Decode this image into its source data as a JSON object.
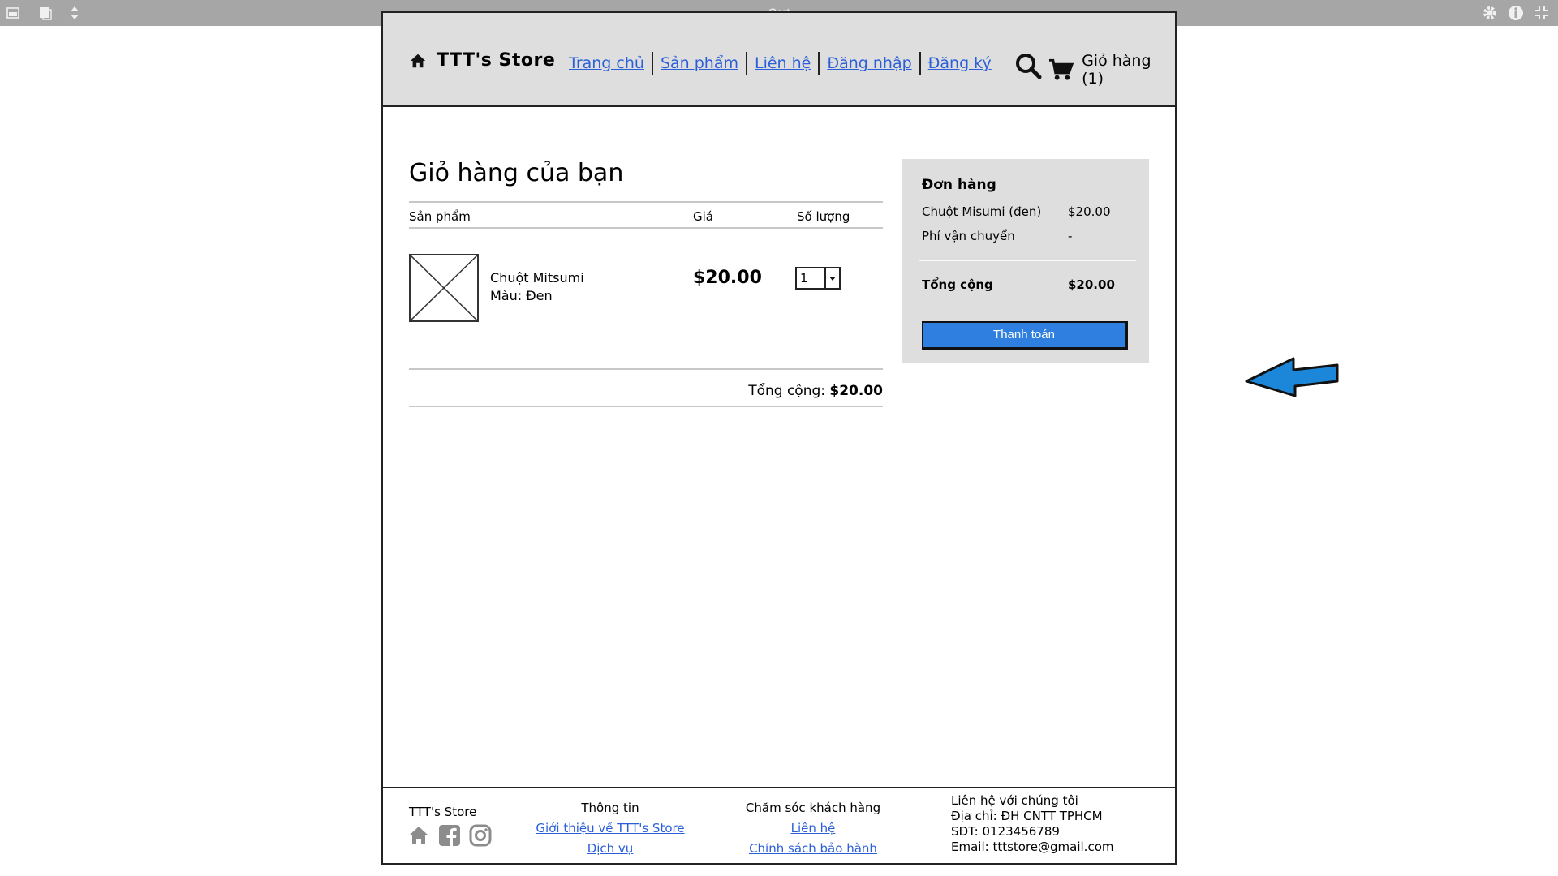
{
  "window": {
    "title": "Cart"
  },
  "header": {
    "brand": "TTT's Store",
    "nav": [
      "Trang chủ",
      "Sản phẩm",
      "Liên hệ",
      "Đăng nhập",
      "Đăng ký"
    ],
    "cart_label": "Giỏ hàng (1)"
  },
  "cart": {
    "title": "Giỏ hàng của bạn",
    "columns": {
      "product": "Sản phẩm",
      "price": "Giá",
      "quantity": "Số lượng"
    },
    "item": {
      "name": "Chuột Mitsumi",
      "color": "Màu: Đen",
      "price": "$20.00",
      "qty": "1"
    },
    "total_label": "Tổng cộng:",
    "total_value": "$20.00"
  },
  "order": {
    "heading": "Đơn hàng",
    "line_item": "Chuột Misumi (đen)",
    "line_value": "$20.00",
    "shipping": "Phí vận chuyển",
    "shipping_value": "-",
    "total_label": "Tổng cộng",
    "total_value": "$20.00",
    "pay_button": "Thanh toán"
  },
  "footer": {
    "brand": "TTT's Store",
    "info_title": "Thông tin",
    "info_links": [
      "Giới thiệu về TTT's Store",
      "Dịch vụ"
    ],
    "care_title": "Chăm sóc khách hàng",
    "care_links": [
      "Liên hệ",
      "Chính sách bảo hành"
    ],
    "contact": [
      "Liên hệ với chúng tôi",
      "Địa chỉ: ĐH CNTT TPHCM",
      "SĐT: 0123456789",
      "Email: tttstore@gmail.com"
    ]
  },
  "colors": {
    "link": "#2b5fd8",
    "button": "#2e7fe0",
    "header_bg": "#dedede",
    "arrow": "#1c86d9"
  }
}
